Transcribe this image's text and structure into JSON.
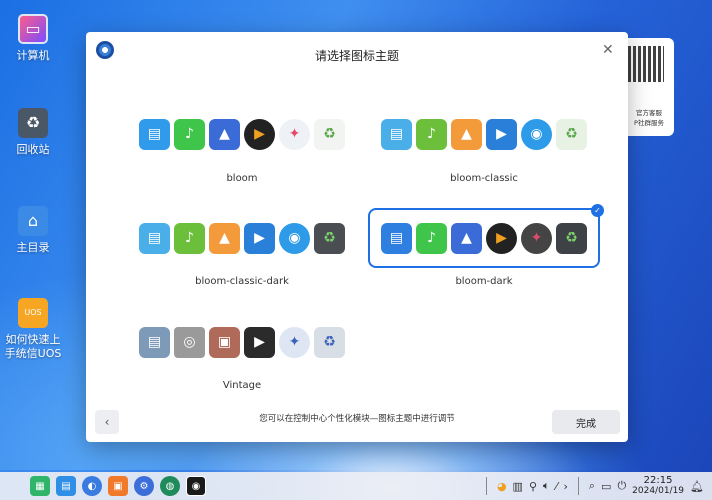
{
  "desktop": {
    "icons": [
      {
        "label": "计算机",
        "icon": "computer-icon"
      },
      {
        "label": "回收站",
        "icon": "trash-icon"
      },
      {
        "label": "主目录",
        "icon": "home-folder-icon"
      },
      {
        "label": "如何快速上\n手统信UOS",
        "icon": "uos-guide-icon"
      }
    ]
  },
  "qr_card": {
    "text": "官方客服\nP社群服务"
  },
  "dialog": {
    "title": "请选择图标主题",
    "themes": [
      {
        "name": "bloom",
        "selected": false,
        "icons": [
          "folder-icon",
          "music-icon",
          "photos-icon",
          "video-player-icon",
          "launcher-icon",
          "trash-icon"
        ]
      },
      {
        "name": "bloom-classic",
        "selected": false,
        "icons": [
          "folder-icon",
          "music-icon",
          "photos-icon",
          "video-icon",
          "deepin-icon",
          "trash-icon"
        ]
      },
      {
        "name": "bloom-classic-dark",
        "selected": false,
        "icons": [
          "folder-icon",
          "music-icon",
          "photos-icon",
          "video-icon",
          "deepin-icon",
          "trash-icon"
        ]
      },
      {
        "name": "bloom-dark",
        "selected": true,
        "icons": [
          "folder-icon",
          "music-icon",
          "photos-icon",
          "video-player-icon",
          "launcher-icon",
          "trash-icon"
        ]
      },
      {
        "name": "Vintage",
        "selected": false,
        "icons": [
          "folder-icon",
          "disk-icon",
          "photos-icon",
          "video-icon",
          "launcher-icon",
          "trash-icon"
        ]
      }
    ],
    "hint": "您可以在控制中心个性化模块—图标主题中进行调节",
    "back_label": "‹",
    "done_label": "完成"
  },
  "taskbar": {
    "clock_time": "22:15",
    "clock_date": "2024/01/19"
  },
  "colors": {
    "accent": "#1f6fe5"
  }
}
